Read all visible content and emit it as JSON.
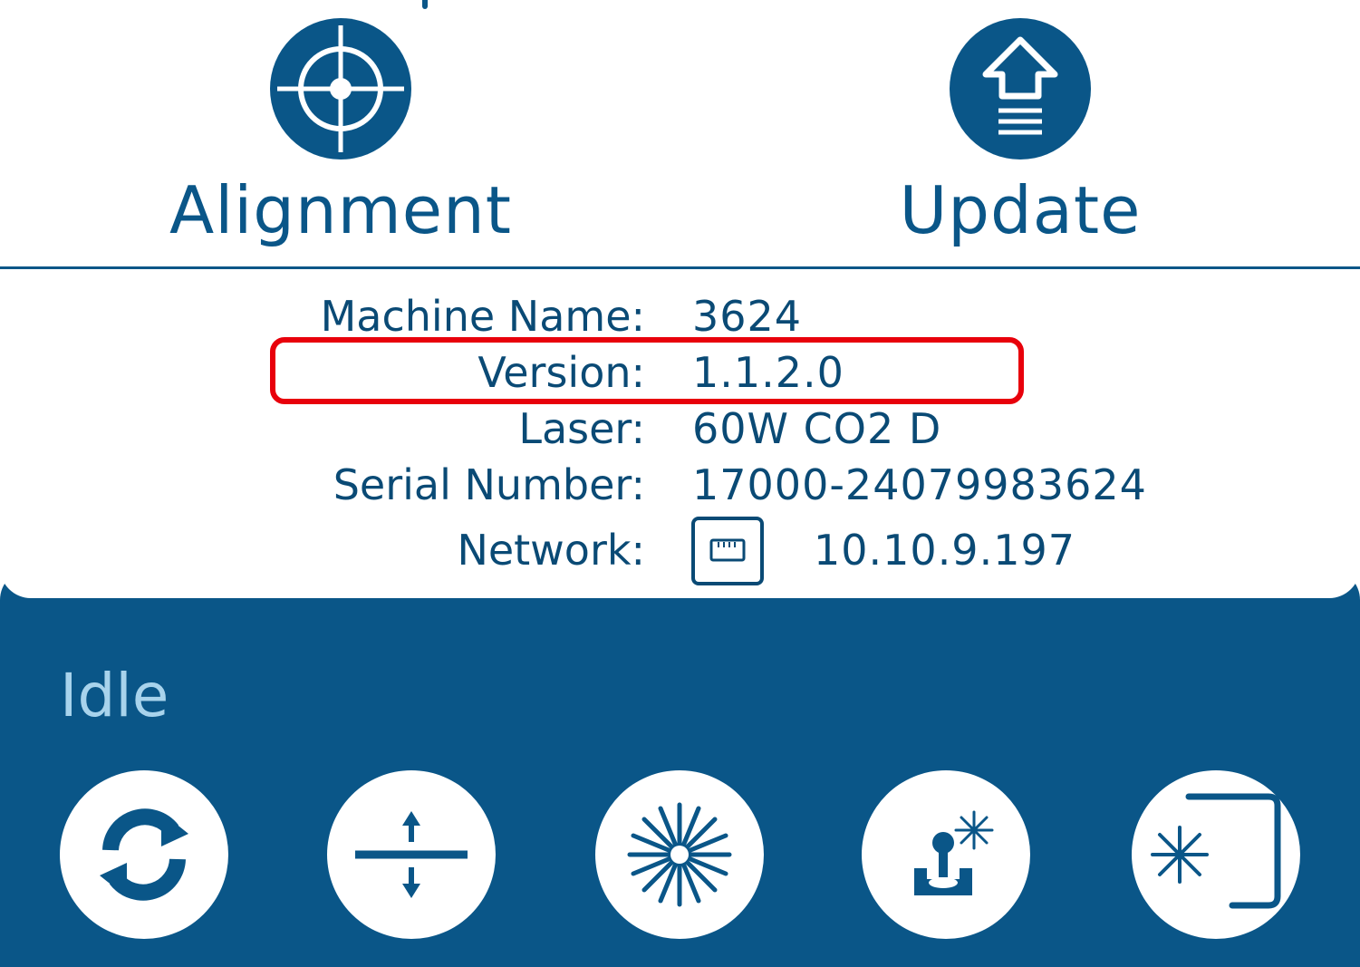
{
  "actions": {
    "alignment": {
      "label": "Alignment",
      "icon": "crosshair-icon"
    },
    "update": {
      "label": "Update",
      "icon": "upload-arrow-icon"
    }
  },
  "info": {
    "machine_name": {
      "key": "Machine Name:",
      "value": "3624"
    },
    "version": {
      "key": "Version:",
      "value": "1.1.2.0"
    },
    "laser": {
      "key": "Laser:",
      "value": "60W CO2 D"
    },
    "serial_number": {
      "key": "Serial Number:",
      "value": "17000-24079983624"
    },
    "network": {
      "key": "Network:",
      "value": "10.10.9.197",
      "icon": "ethernet-port-icon"
    }
  },
  "status": {
    "text": "Idle"
  },
  "toolbar": [
    {
      "icon": "refresh-icon"
    },
    {
      "icon": "focus-height-icon"
    },
    {
      "icon": "laser-fire-icon"
    },
    {
      "icon": "jog-laser-icon"
    },
    {
      "icon": "trace-frame-icon"
    }
  ],
  "colors": {
    "primary": "#0a5688",
    "text": "#0a4a75",
    "status_text": "#a8d3ec",
    "highlight": "#e8000b",
    "background": "#ffffff"
  }
}
